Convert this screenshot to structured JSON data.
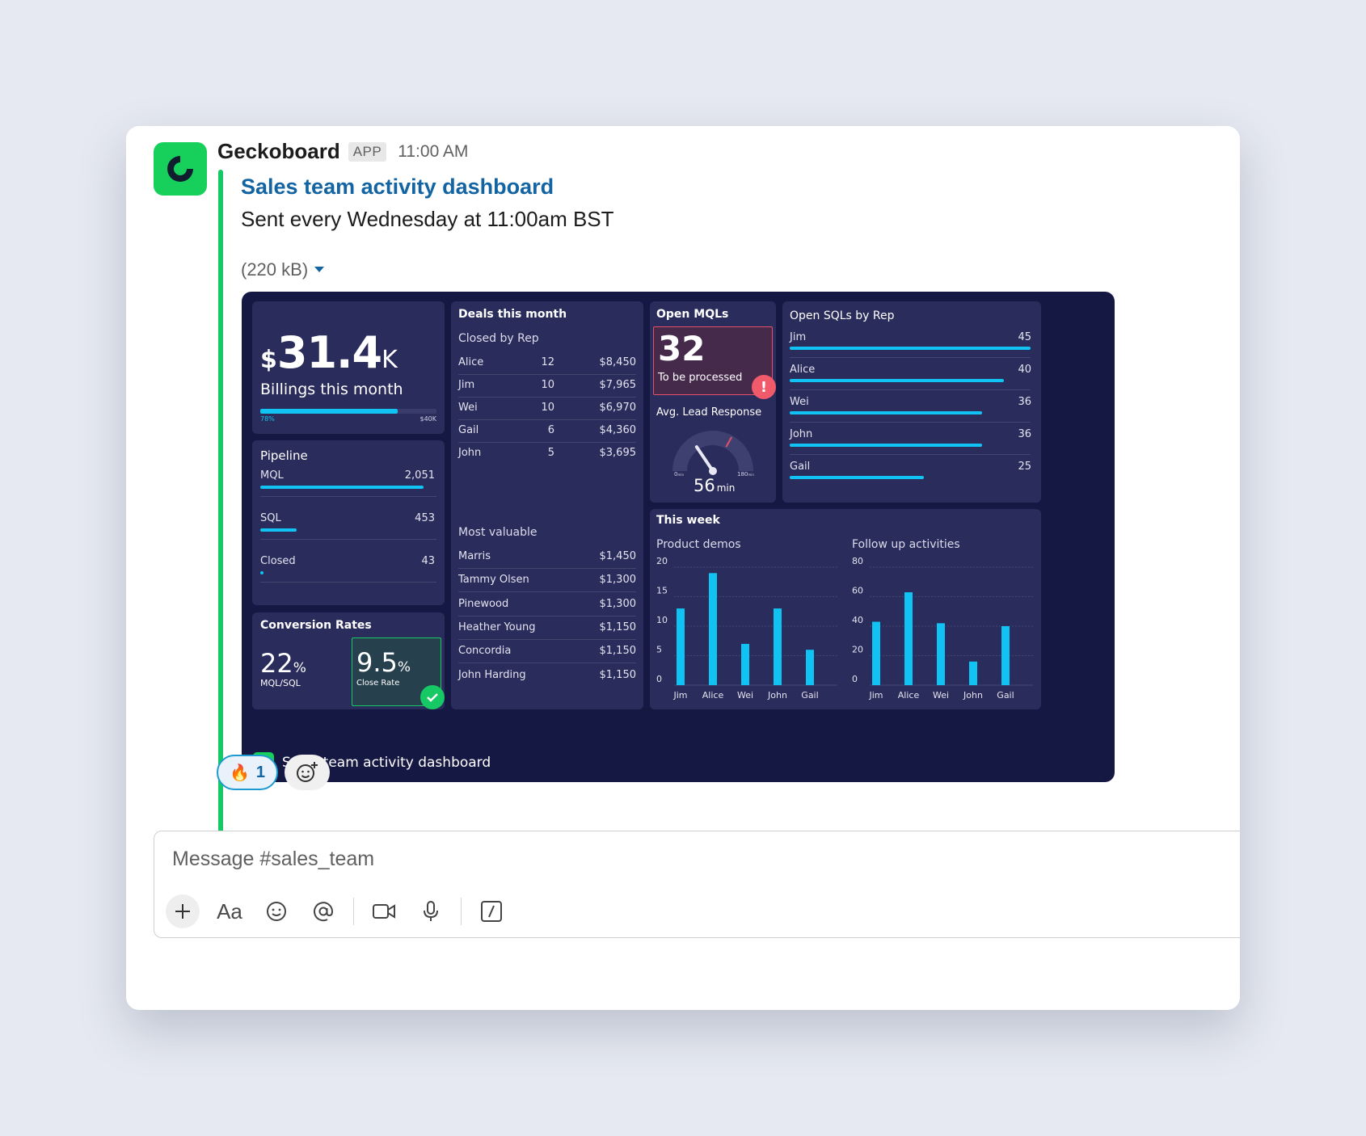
{
  "message": {
    "sender": "Geckoboard",
    "badge": "APP",
    "time": "11:00 AM",
    "title": "Sales team activity dashboard",
    "text": "Sent every Wednesday at 11:00am BST",
    "file_size": "(220 kB)",
    "colors": {
      "accent_bar": "#17c964",
      "link": "#1264a3",
      "logo": "#17d05b"
    }
  },
  "dashboard": {
    "billings": {
      "currency": "$",
      "value": "31.4",
      "suffix": "K",
      "label": "Billings this month",
      "progress": 0.78,
      "progress_label": "78%",
      "target_label": "$40K"
    },
    "pipeline": {
      "title": "Pipeline",
      "max": 2051,
      "rows": [
        {
          "label": "MQL",
          "value": "2,051",
          "num": 2051
        },
        {
          "label": "SQL",
          "value": "453",
          "num": 453
        },
        {
          "label": "Closed",
          "value": "43",
          "num": 43
        }
      ]
    },
    "conversion": {
      "title": "Conversion Rates",
      "a_value": "22",
      "a_unit": "%",
      "a_label": "MQL/SQL",
      "b_value": "9.5",
      "b_unit": "%",
      "b_label": "Close Rate"
    },
    "deals": {
      "title": "Deals this month",
      "closed_title": "Closed by Rep",
      "closed": [
        {
          "name": "Alice",
          "count": "12",
          "amount": "$8,450"
        },
        {
          "name": "Jim",
          "count": "10",
          "amount": "$7,965"
        },
        {
          "name": "Wei",
          "count": "10",
          "amount": "$6,970"
        },
        {
          "name": "Gail",
          "count": "6",
          "amount": "$4,360"
        },
        {
          "name": "John",
          "count": "5",
          "amount": "$3,695"
        }
      ],
      "valuable_title": "Most valuable",
      "valuable": [
        {
          "name": "Marris",
          "amount": "$1,450"
        },
        {
          "name": "Tammy Olsen",
          "amount": "$1,300"
        },
        {
          "name": "Pinewood",
          "amount": "$1,300"
        },
        {
          "name": "Heather Young",
          "amount": "$1,150"
        },
        {
          "name": "Concordia",
          "amount": "$1,150"
        },
        {
          "name": "John Harding",
          "amount": "$1,150"
        }
      ]
    },
    "mqls": {
      "title": "Open MQLs",
      "value": "32",
      "label": "To be processed",
      "alert": "!",
      "gauge_title": "Avg. Lead Response",
      "gauge_value": "56",
      "gauge_unit": "min",
      "gauge_min": "0",
      "gauge_min_unit": "min",
      "gauge_max": "180",
      "gauge_max_unit": "min",
      "gauge_num": 56,
      "gauge_max_num": 180
    },
    "sqls": {
      "title": "Open SQLs by Rep",
      "max": 45,
      "rows": [
        {
          "label": "Jim",
          "value": "45",
          "num": 45
        },
        {
          "label": "Alice",
          "value": "40",
          "num": 40
        },
        {
          "label": "Wei",
          "value": "36",
          "num": 36
        },
        {
          "label": "John",
          "value": "36",
          "num": 36
        },
        {
          "label": "Gail",
          "value": "25",
          "num": 25
        }
      ]
    },
    "week": {
      "title": "This week",
      "demos_title": "Product demos",
      "followup_title": "Follow up activities"
    },
    "footer": "Sales team activity dashboard"
  },
  "chart_data": [
    {
      "type": "bar",
      "title": "Product demos",
      "categories": [
        "Jim",
        "Alice",
        "Wei",
        "John",
        "Gail"
      ],
      "values": [
        13,
        19,
        7,
        13,
        6
      ],
      "ylim": [
        0,
        20
      ],
      "yticks": [
        "0",
        "5",
        "10",
        "15",
        "20"
      ],
      "color": "#10c3f2"
    },
    {
      "type": "bar",
      "title": "Follow up activities",
      "categories": [
        "Jim",
        "Alice",
        "Wei",
        "John",
        "Gail"
      ],
      "values": [
        43,
        63,
        42,
        16,
        40
      ],
      "ylim": [
        0,
        80
      ],
      "yticks": [
        "0",
        "20",
        "40",
        "60",
        "80"
      ],
      "color": "#10c3f2"
    }
  ],
  "reactions": [
    {
      "emoji": "🔥",
      "count": "1"
    }
  ],
  "composer": {
    "placeholder": "Message #sales_team",
    "format_label": "Aa"
  }
}
